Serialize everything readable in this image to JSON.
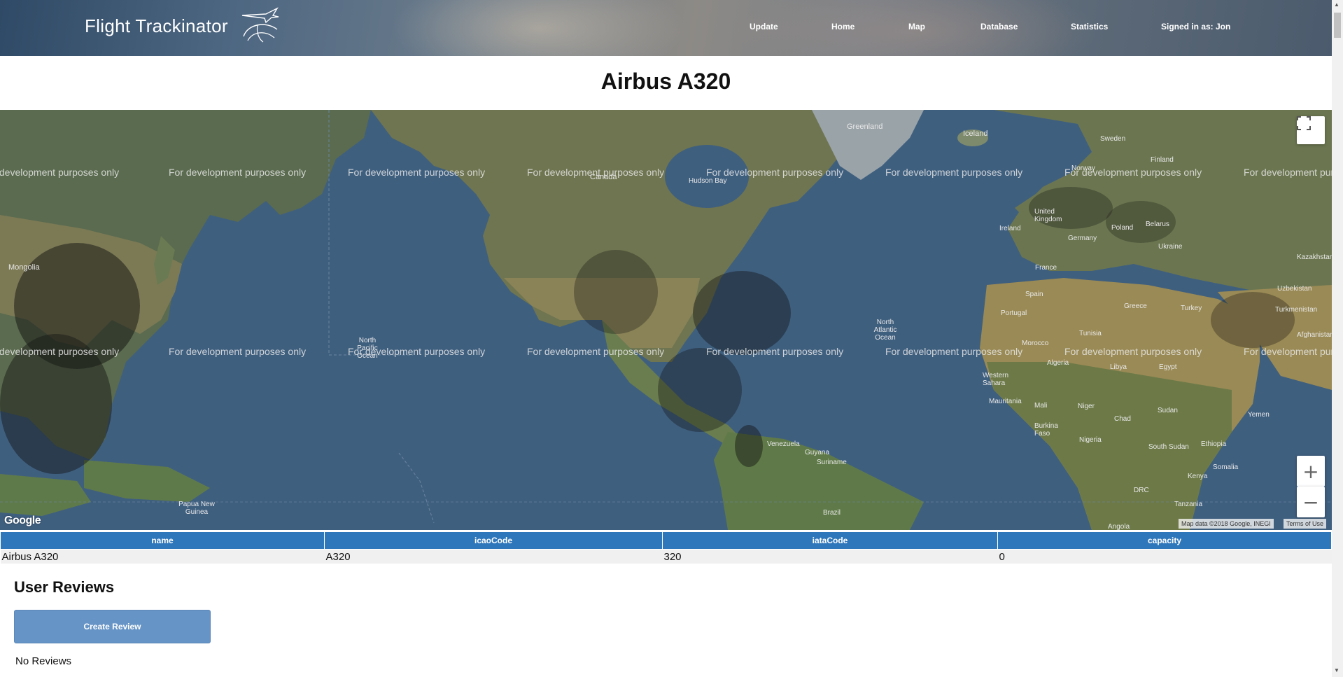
{
  "app": {
    "title": "Flight Trackinator"
  },
  "nav": {
    "items": [
      {
        "label": "Update"
      },
      {
        "label": "Home"
      },
      {
        "label": "Map"
      },
      {
        "label": "Database"
      },
      {
        "label": "Statistics"
      },
      {
        "label": "Signed in as: Jon"
      }
    ]
  },
  "page": {
    "title": "Airbus A320"
  },
  "map": {
    "dev_watermark": "For development purposes only",
    "labels": [
      "Greenland",
      "Iceland",
      "Sweden",
      "Finland",
      "Norway",
      "Canada",
      "Hudson Bay",
      "Mongolia",
      "North Pacific Ocean",
      "North Atlantic Ocean",
      "Ireland",
      "United Kingdom",
      "France",
      "Poland",
      "Ukraine",
      "Kazakhstan",
      "Uzbekistan",
      "Turkmenistan",
      "Spain",
      "Portugal",
      "Morocco",
      "Algeria",
      "Libya",
      "Egypt",
      "Turkey",
      "Afghanistan",
      "Mauritania",
      "Mali",
      "Niger",
      "Chad",
      "Sudan",
      "Nigeria",
      "Ethiopia",
      "South Sudan",
      "Kenya",
      "Somalia",
      "DRC",
      "Tanzania",
      "Angola",
      "Venezuela",
      "Guyana",
      "Suriname",
      "Brazil",
      "Papua New Guinea",
      "Greece",
      "Belarus",
      "Germany",
      "Western Sahara",
      "Burkina Faso",
      "Tunisia",
      "Yemen"
    ],
    "attribution": "Map data ©2018 Google, INEGI",
    "terms": "Terms of Use",
    "google_logo": "Google"
  },
  "table": {
    "headers": [
      "name",
      "icaoCode",
      "iataCode",
      "capacity"
    ],
    "rows": [
      [
        "Airbus A320",
        "A320",
        "320",
        "0"
      ]
    ]
  },
  "reviews": {
    "heading": "User Reviews",
    "create_button": "Create Review",
    "empty_text": "No Reviews"
  }
}
